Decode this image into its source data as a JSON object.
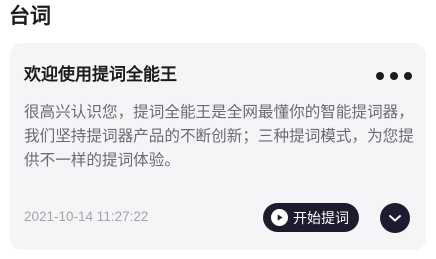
{
  "section": {
    "title": "台词"
  },
  "card": {
    "title": "欢迎使用提词全能王",
    "body": "很高兴认识您，提词全能王是全网最懂你的智能提词器，我们坚持提词器产品的不断创新；三种提词模式，为您提供不一样的提词体验。",
    "timestamp": "2021-10-14 11:27:22",
    "start_label": "开始提词",
    "icons": {
      "more": "more-dots-icon",
      "play": "play-icon",
      "expand": "chevron-down-icon"
    }
  },
  "colors": {
    "background": "#ffffff",
    "card_background": "#f5f5f7",
    "title_text": "#1c1c1e",
    "body_text": "#6b6b70",
    "timestamp_text": "#a4a4a8",
    "button_background": "#1c1c2e",
    "button_text": "#ffffff"
  }
}
